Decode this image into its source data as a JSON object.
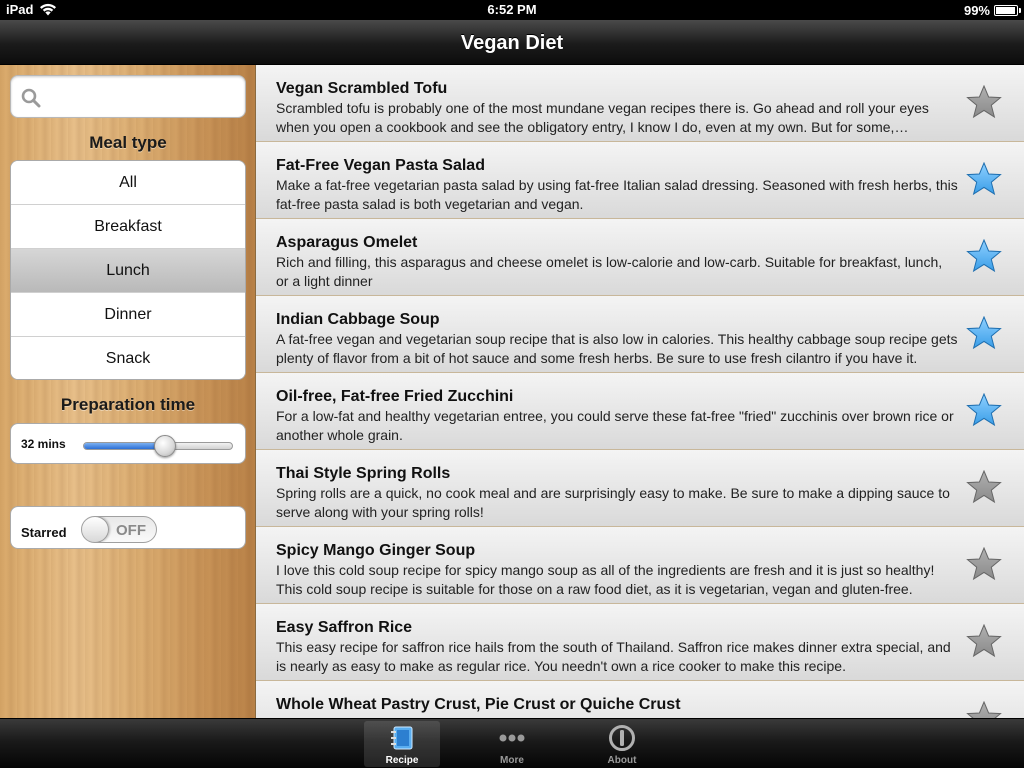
{
  "status_bar": {
    "carrier": "iPad",
    "time": "6:52 PM",
    "battery_text": "99%",
    "battery_level": 0.99
  },
  "nav": {
    "title": "Vegan Diet"
  },
  "sidebar": {
    "search": {
      "value": "",
      "placeholder": ""
    },
    "meal_type": {
      "label": "Meal type",
      "options": [
        "All",
        "Breakfast",
        "Lunch",
        "Dinner",
        "Snack"
      ],
      "selected": "Lunch"
    },
    "prep_time": {
      "label": "Preparation time",
      "value_text": "32 mins",
      "slider_fraction": 0.54
    },
    "starred": {
      "label": "Starred",
      "toggle_text": "OFF"
    }
  },
  "recipes": [
    {
      "title": "Vegan Scrambled Tofu",
      "desc": "Scrambled tofu is probably one of the most mundane vegan recipes there is. Go ahead and roll your eyes when you open a cookbook and see the obligatory entry, I know I do, even at my own. But for some, scrambled tofu is a new and exciting dish.",
      "starred": false
    },
    {
      "title": "Fat-Free Vegan Pasta Salad",
      "desc": "Make a fat-free vegetarian pasta salad by using fat-free Italian salad dressing. Seasoned with fresh herbs, this fat-free pasta salad is both vegetarian and vegan.",
      "starred": true
    },
    {
      "title": "Asparagus Omelet",
      "desc": "Rich and filling, this asparagus and cheese omelet is low-calorie and low-carb. Suitable for breakfast, lunch, or a light dinner",
      "starred": true
    },
    {
      "title": "Indian Cabbage Soup",
      "desc": "A fat-free vegan and vegetarian soup recipe that is also low in calories. This healthy cabbage soup recipe gets plenty of flavor from a bit of hot sauce and some fresh herbs. Be sure to use fresh cilantro if you have it.",
      "starred": true
    },
    {
      "title": "Oil-free, Fat-free Fried Zucchini",
      "desc": "For a low-fat and healthy vegetarian entree, you could serve these fat-free \"fried\" zucchinis over brown rice or another whole grain.",
      "starred": true
    },
    {
      "title": "Thai Style Spring Rolls",
      "desc": "Spring rolls are a quick, no cook meal and are surprisingly easy to make. Be sure to make a dipping sauce to serve along with your spring rolls!",
      "starred": false
    },
    {
      "title": "Spicy Mango Ginger Soup",
      "desc": "I love this cold soup recipe for spicy mango soup as all of the ingredients are fresh and it is just so healthy! This cold soup recipe is suitable for those on a raw food diet, as it is vegetarian, vegan and gluten-free.",
      "starred": false
    },
    {
      "title": "Easy Saffron Rice",
      "desc": "This easy recipe for saffron rice hails from the south of Thailand. Saffron rice makes dinner extra special, and is nearly as easy to make as regular rice. You needn't own a rice cooker to make this recipe.",
      "starred": false
    },
    {
      "title": "Whole Wheat Pastry Crust, Pie Crust or Quiche Crust",
      "desc": "",
      "starred": false
    }
  ],
  "tabs": [
    {
      "label": "Recipe",
      "icon": "recipe-book-icon",
      "active": true
    },
    {
      "label": "More",
      "icon": "more-dots-icon",
      "active": false
    },
    {
      "label": "About",
      "icon": "about-power-icon",
      "active": false
    }
  ],
  "colors": {
    "star_active": "#3a9ee8",
    "star_inactive": "#8a8a8a",
    "slider_fill": "#2c6fd6"
  }
}
